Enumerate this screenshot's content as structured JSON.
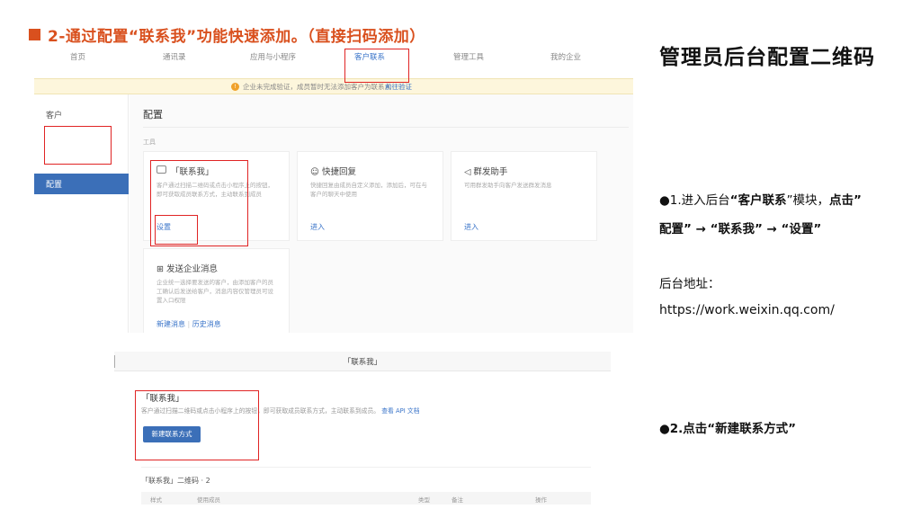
{
  "heading": "2-通过配置“联系我”功能快速添加。（直接扫码添加）",
  "right_title": "管理员后台配置二维码",
  "step1": {
    "bullet": "●",
    "t1": "1.进入后台",
    "b1": "“客户联系",
    "t2": "”模块，",
    "b2": "点击”",
    "line2": "配置” → “联系我” → “设置”"
  },
  "address_label": "后台地址：",
  "address_url": "https://work.weixin.qq.com/",
  "step2": "●2.点击“新建联系方式”",
  "shot1": {
    "nav": [
      "首页",
      "通讯录",
      "应用与小程序",
      "客户联系",
      "管理工具",
      "我的企业"
    ],
    "notice_icon": "!",
    "notice_text": "企业未完成验证，成员暂时无法添加客户为联系人",
    "notice_link": "前往验证",
    "sidebar_customer": "客户",
    "sidebar_config": "配置",
    "page_title": "配置",
    "tools_label": "工具",
    "card_contact": {
      "title": "「联系我」",
      "desc": "客户通过扫描二维码或点击小程序上的按钮，即可获取成员联系方式，主动联系到成员",
      "action": "设置"
    },
    "card_quick": {
      "title": "快捷回复",
      "desc": "快捷回复由成员自定义添加，添加后，可在与客户的聊天中使用",
      "action": "进入"
    },
    "card_mass": {
      "title": "群发助手",
      "desc": "可用群发助手向客户发送群发消息",
      "action": "进入"
    },
    "card_send": {
      "title": "发送企业消息",
      "desc": "企业统一选择要发送的客户，由添加客户的员工确认后发送给客户，消息内容仅管理员可设置入口权限",
      "action1": "新建消息",
      "action2": "历史消息"
    }
  },
  "shot2": {
    "bar_title": "「联系我」",
    "section_title": "「联系我」",
    "desc": "客户通过扫描二维码或点击小程序上的按钮，即可获取成员联系方式，主动联系到成员。",
    "desc_link": "查看 API 文档",
    "button": "新建联系方式",
    "sub": "「联系我」二维码 · 2",
    "table_headers": [
      "样式",
      "使用成员",
      "类型",
      "备注",
      "操作"
    ]
  }
}
